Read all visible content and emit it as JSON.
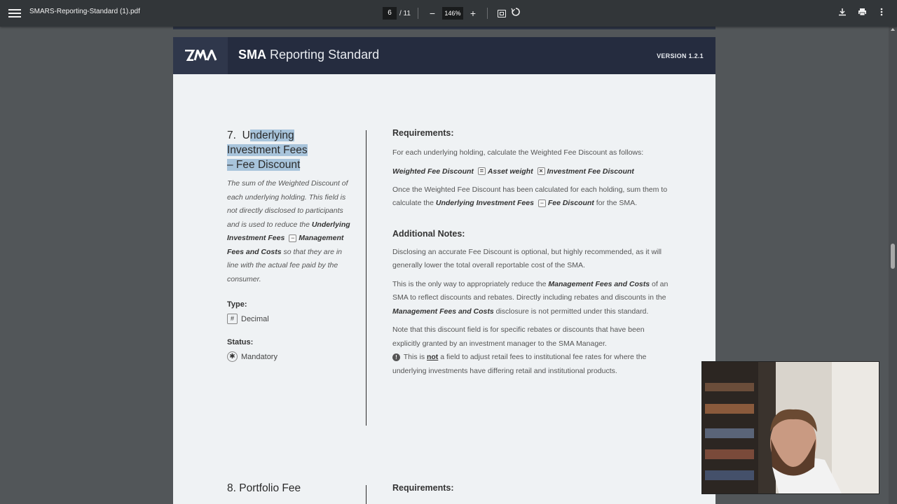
{
  "toolbar": {
    "filename": "SMARS-Reporting-Standard (1).pdf",
    "current_page": "6",
    "total_pages": "/ 11",
    "zoom": "146%",
    "zoom_out": "−",
    "zoom_in": "+"
  },
  "header": {
    "title_bold": "SMA",
    "title_light": "Reporting Standard",
    "version": "VERSION 1.2.1"
  },
  "section7": {
    "number": "7.",
    "title_prefix": "U",
    "title_line1_hl": "nderlying ",
    "title_line2_hl": "Investment Fees ",
    "title_line3_hl": "– Fee Discount",
    "desc_1": "The sum of the Weighted Discount of each underlying holding. This field is not directly disclosed to participants and is used to reduce the ",
    "desc_b1": "Underlying Investment Fees",
    "desc_op": "−",
    "desc_b2": "Management Fees and Costs",
    "desc_2": " so that they are in line with the actual fee paid by the consumer.",
    "type_label": "Type:",
    "type_value": "Decimal",
    "type_icon": "#",
    "status_label": "Status:",
    "status_value": "Mandatory",
    "status_icon": "✱",
    "requirements_heading": "Requirements:",
    "req_p1": "For each underlying holding, calculate the Weighted Fee Discount as follows:",
    "formula_a": "Weighted Fee Discount",
    "formula_eq": "=",
    "formula_b": "Asset weight",
    "formula_x": "×",
    "formula_c": "Investment Fee Discount",
    "req_p2_a": "Once the Weighted Fee Discount has been calculated for each holding, sum them to calculate the ",
    "req_p2_b1": "Underlying Investment Fees",
    "req_p2_op": "−",
    "req_p2_b2": "Fee Discount",
    "req_p2_c": " for the SMA.",
    "notes_heading": "Additional Notes:",
    "note1": "Disclosing an accurate Fee Discount is optional, but highly recommended, as it will generally lower the total overall reportable cost of the SMA.",
    "note2_a": "This is the only way to appropriately reduce the ",
    "note2_b1": "Management Fees and Costs",
    "note2_c": " of an SMA to reflect discounts and rebates. Directly including rebates and discounts in the ",
    "note2_b2": "Management Fees and Costs",
    "note2_d": " disclosure is not permitted under this standard.",
    "note3_a": "Note that this discount field is for specific rebates or discounts that have been explicitly granted by an investment manager to the SMA Manager.",
    "note3_warn": "!",
    "note3_b": " This is ",
    "note3_not": "not",
    "note3_c": " a field to adjust retail fees to institutional fee rates for where the underlying investments have differing retail and institutional products."
  },
  "section8": {
    "title": "8.  Portfolio Fee",
    "requirements_heading": "Requirements:"
  },
  "icons": {
    "menu": "hamburger-icon",
    "fit": "fit-page-icon",
    "rotate": "rotate-icon",
    "download": "download-icon",
    "print": "print-icon",
    "more": "more-vertical-icon"
  }
}
